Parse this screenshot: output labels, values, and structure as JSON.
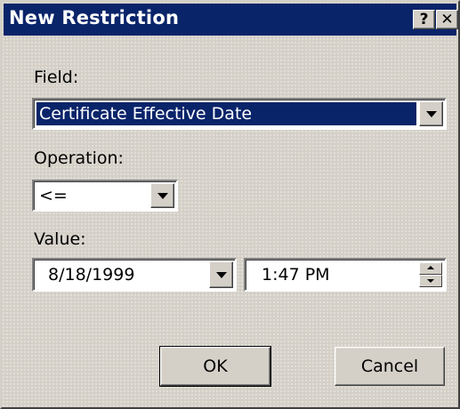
{
  "dialog": {
    "title": "New Restriction",
    "help_glyph": "?",
    "close_glyph": "✕",
    "colors": {
      "titlebar": "#0a246a",
      "face": "#d4d0c8",
      "selection": "#0a246a"
    }
  },
  "field": {
    "label": "Field:",
    "selected": "Certificate Effective Date"
  },
  "operation": {
    "label": "Operation:",
    "selected": "<="
  },
  "value": {
    "label": "Value:",
    "date": "8/18/1999",
    "time": "1:47 PM"
  },
  "buttons": {
    "ok": "OK",
    "cancel": "Cancel"
  },
  "icons": {
    "help": "help-icon",
    "close": "close-icon",
    "dropdown": "chevron-down-icon",
    "spin_up": "spin-up-icon",
    "spin_down": "spin-down-icon"
  }
}
